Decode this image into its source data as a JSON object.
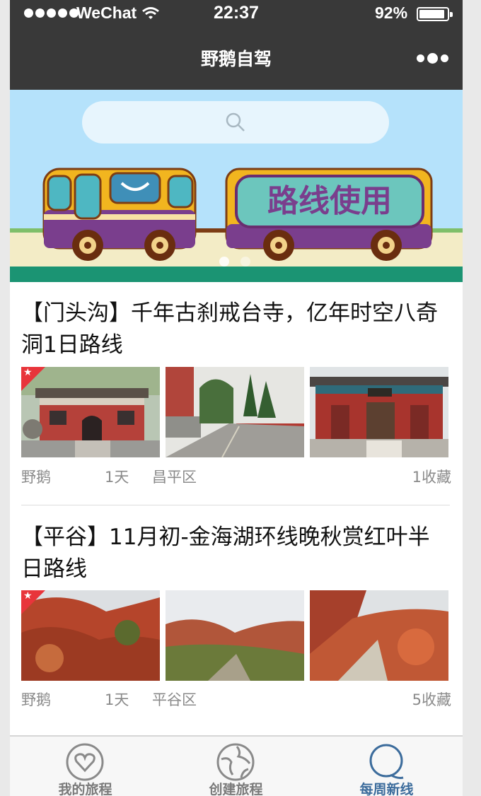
{
  "status_bar": {
    "carrier": "WeChat",
    "time": "22:37",
    "battery": "92%",
    "battery_level": 0.92
  },
  "nav": {
    "title": "野鹅自驾",
    "more_icon": "more-dots-icon"
  },
  "banner": {
    "search_icon": "search-icon",
    "sign_text": "路线使用",
    "slide_count": 2,
    "active_slide": 0
  },
  "routes": [
    {
      "title": "【门头沟】千年古刹戒台寺，亿年时空八奇洞1日路线",
      "author": "野鹅",
      "days": "1天",
      "district": "昌平区",
      "favorites": "1收藏",
      "featured": true
    },
    {
      "title": "【平谷】11月初-金海湖环线晚秋赏红叶半日路线",
      "author": "野鹅",
      "days": "1天",
      "district": "平谷区",
      "favorites": "5收藏",
      "featured": true
    }
  ],
  "tabbar": {
    "items": [
      {
        "label": "我的旅程",
        "icon": "heart-circle-icon",
        "active": false
      },
      {
        "label": "创建旅程",
        "icon": "globe-icon",
        "active": false
      },
      {
        "label": "每周新线",
        "icon": "magnify-q-icon",
        "active": true
      }
    ]
  },
  "colors": {
    "nav_bg": "#393939",
    "banner_sky": "#b5e2fb",
    "featured_badge": "#e8353b",
    "tab_active": "#3c6c9c"
  }
}
